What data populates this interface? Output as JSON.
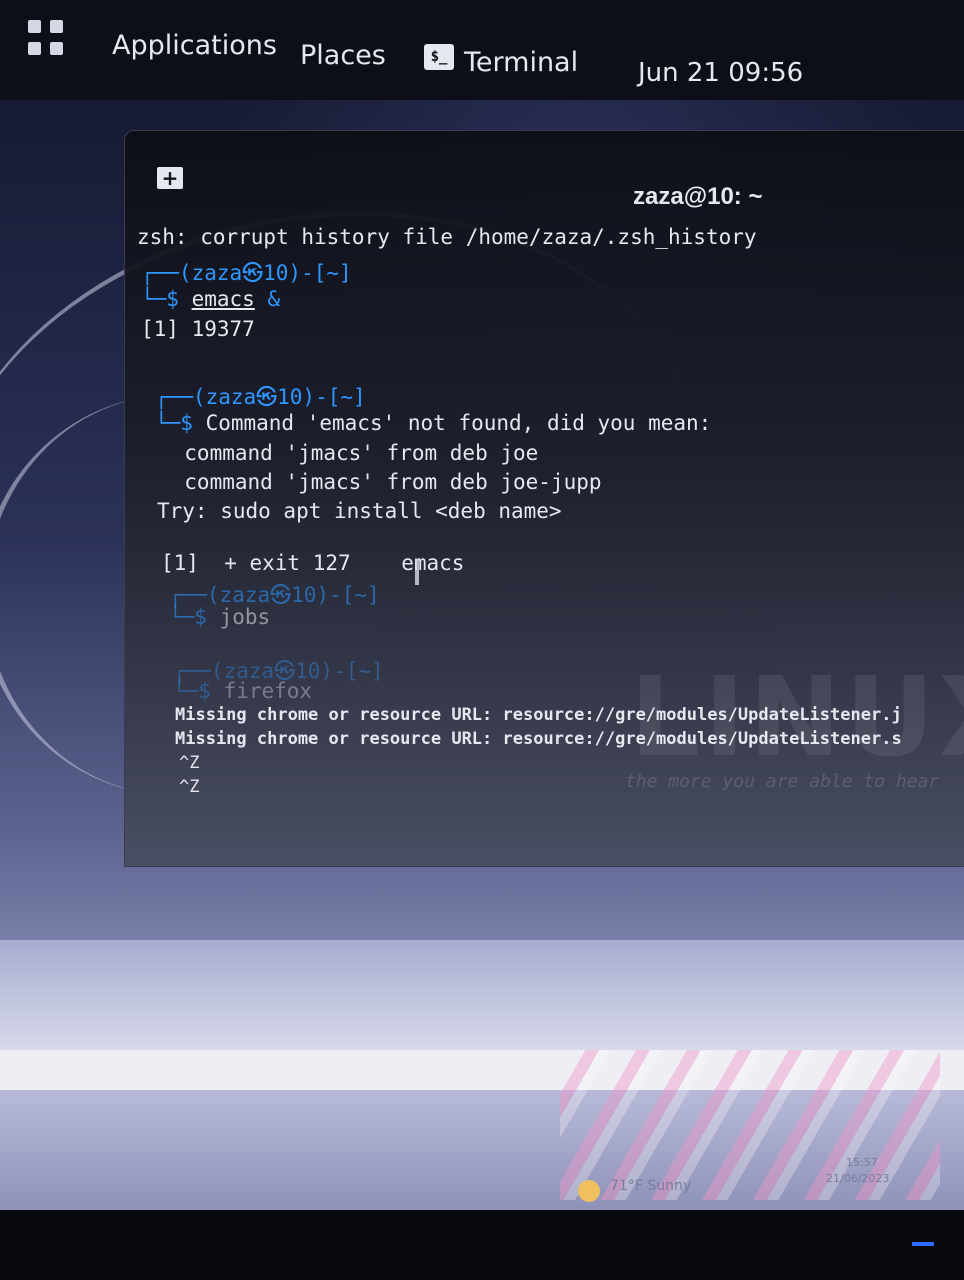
{
  "top_panel": {
    "applications": "Applications",
    "places": "Places",
    "terminal_icon": "$_",
    "terminal": "Terminal",
    "datetime": "Jun 21  09:56"
  },
  "window": {
    "new_tab_icon": "+",
    "title": "zaza@10: ~"
  },
  "terminal": {
    "l1": "zsh: corrupt history file /home/zaza/.zsh_history",
    "p1_prompt": "┌──(zaza㉿10)-[~]",
    "p1_dollar": "└─$ ",
    "p1_cmd": "emacs",
    "p1_amp": " &",
    "job_start": "[1] 19377",
    "p2_prompt": "┌──(zaza㉿10)-[~]",
    "p2_dollar": "└─$ ",
    "notfound": "Command 'emacs' not found, did you mean:",
    "suggest1": "  command 'jmacs' from deb joe",
    "suggest2": "  command 'jmacs' from deb joe-jupp",
    "try": "Try: sudo apt install <deb name>",
    "exit_line": "[1]  + exit 127    emacs",
    "p3_prompt": "┌──(zaza㉿10)-[~]",
    "p3_dollar": "└─$ ",
    "p3_cmd": "jobs",
    "p4_prompt": "┌──(zaza㉿10)-[~]",
    "p4_dollar": "└─$ ",
    "p4_cmd": "firefox",
    "missing1": "Missing chrome or resource URL: resource://gre/modules/UpdateListener.j",
    "missing2": "Missing chrome or resource URL: resource://gre/modules/UpdateListener.s",
    "ctrlz1": "^Z",
    "ctrlz2": "^Z"
  },
  "watermark": {
    "text": "LINUX",
    "tagline": "the more you are able to hear"
  },
  "taskbar": {
    "weather": "71°F  Sunny",
    "time": "15:57",
    "date": "21/06/2023"
  },
  "colors": {
    "prompt_blue": "#2f96ff",
    "text": "#e6e8f0"
  }
}
